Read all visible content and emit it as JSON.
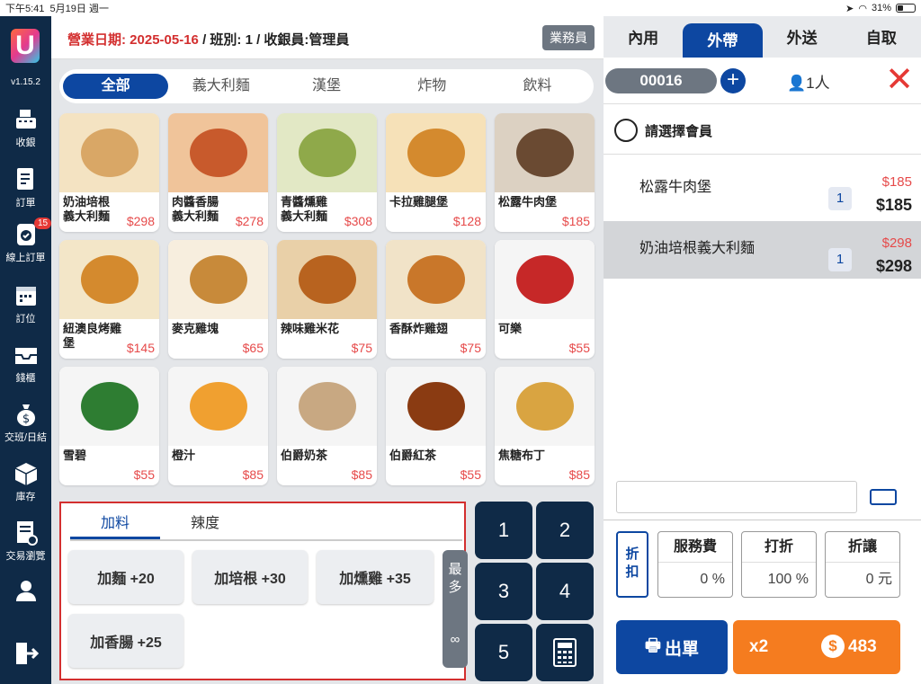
{
  "status": {
    "time": "下午5:41",
    "date": "5月19日 週一",
    "battery": "31%"
  },
  "sidebar": {
    "version": "v1.15.2",
    "items": [
      {
        "label": "收銀"
      },
      {
        "label": "訂單"
      },
      {
        "label": "線上訂單",
        "badge": "15"
      },
      {
        "label": "訂位"
      },
      {
        "label": "錢櫃"
      },
      {
        "label": "交班/日結"
      },
      {
        "label": "庫存"
      },
      {
        "label": "交易瀏覽"
      }
    ]
  },
  "header": {
    "date_label": "營業日期: 2025-05-16",
    "rest": " / 班別: 1 / 收銀員:管理員",
    "staff_button": "業務員"
  },
  "categories": [
    "全部",
    "義大利麵",
    "漢堡",
    "炸物",
    "飲料"
  ],
  "products": [
    {
      "name": "奶油培根\n義大利麵",
      "price": "$298"
    },
    {
      "name": "肉醬香腸\n義大利麵",
      "price": "$278"
    },
    {
      "name": "青醬燻雞\n義大利麵",
      "price": "$308"
    },
    {
      "name": "卡拉雞腿堡",
      "price": "$128"
    },
    {
      "name": "松露牛肉堡",
      "price": "$185"
    },
    {
      "name": "紐澳良烤雞堡",
      "price": "$145"
    },
    {
      "name": "麥克雞塊",
      "price": "$65"
    },
    {
      "name": "辣味雞米花",
      "price": "$75"
    },
    {
      "name": "香酥炸雞翅",
      "price": "$75"
    },
    {
      "name": "可樂",
      "price": "$55"
    },
    {
      "name": "雪碧",
      "price": "$55"
    },
    {
      "name": "橙汁",
      "price": "$85"
    },
    {
      "name": "伯爵奶茶",
      "price": "$85"
    },
    {
      "name": "伯爵紅茶",
      "price": "$55"
    },
    {
      "name": "焦糖布丁",
      "price": "$85"
    }
  ],
  "options": {
    "tabs": [
      "加料",
      "辣度"
    ],
    "addons": [
      "加麵 +20",
      "加培根 +30",
      "加燻雞 +35",
      "加香腸 +25"
    ],
    "most_label": "最多",
    "most_value": "∞"
  },
  "keypad": [
    "1",
    "2",
    "3",
    "4",
    "5"
  ],
  "order": {
    "types": [
      "內用",
      "外帶",
      "外送",
      "自取"
    ],
    "number": "00016",
    "people": "1人",
    "member": "請選擇會員",
    "items": [
      {
        "name": "松露牛肉堡",
        "price": "$185",
        "qty": "1",
        "total": "$185"
      },
      {
        "name": "奶油培根義大利麵",
        "price": "$298",
        "qty": "1",
        "total": "$298"
      }
    ],
    "discount_btn": "折扣",
    "service": {
      "label": "服務費",
      "value": "0 %"
    },
    "percent": {
      "label": "打折",
      "value": "100 %"
    },
    "allow": {
      "label": "折讓",
      "value": "0 元"
    },
    "print_btn": "出單",
    "count": "x2",
    "total": "483"
  }
}
